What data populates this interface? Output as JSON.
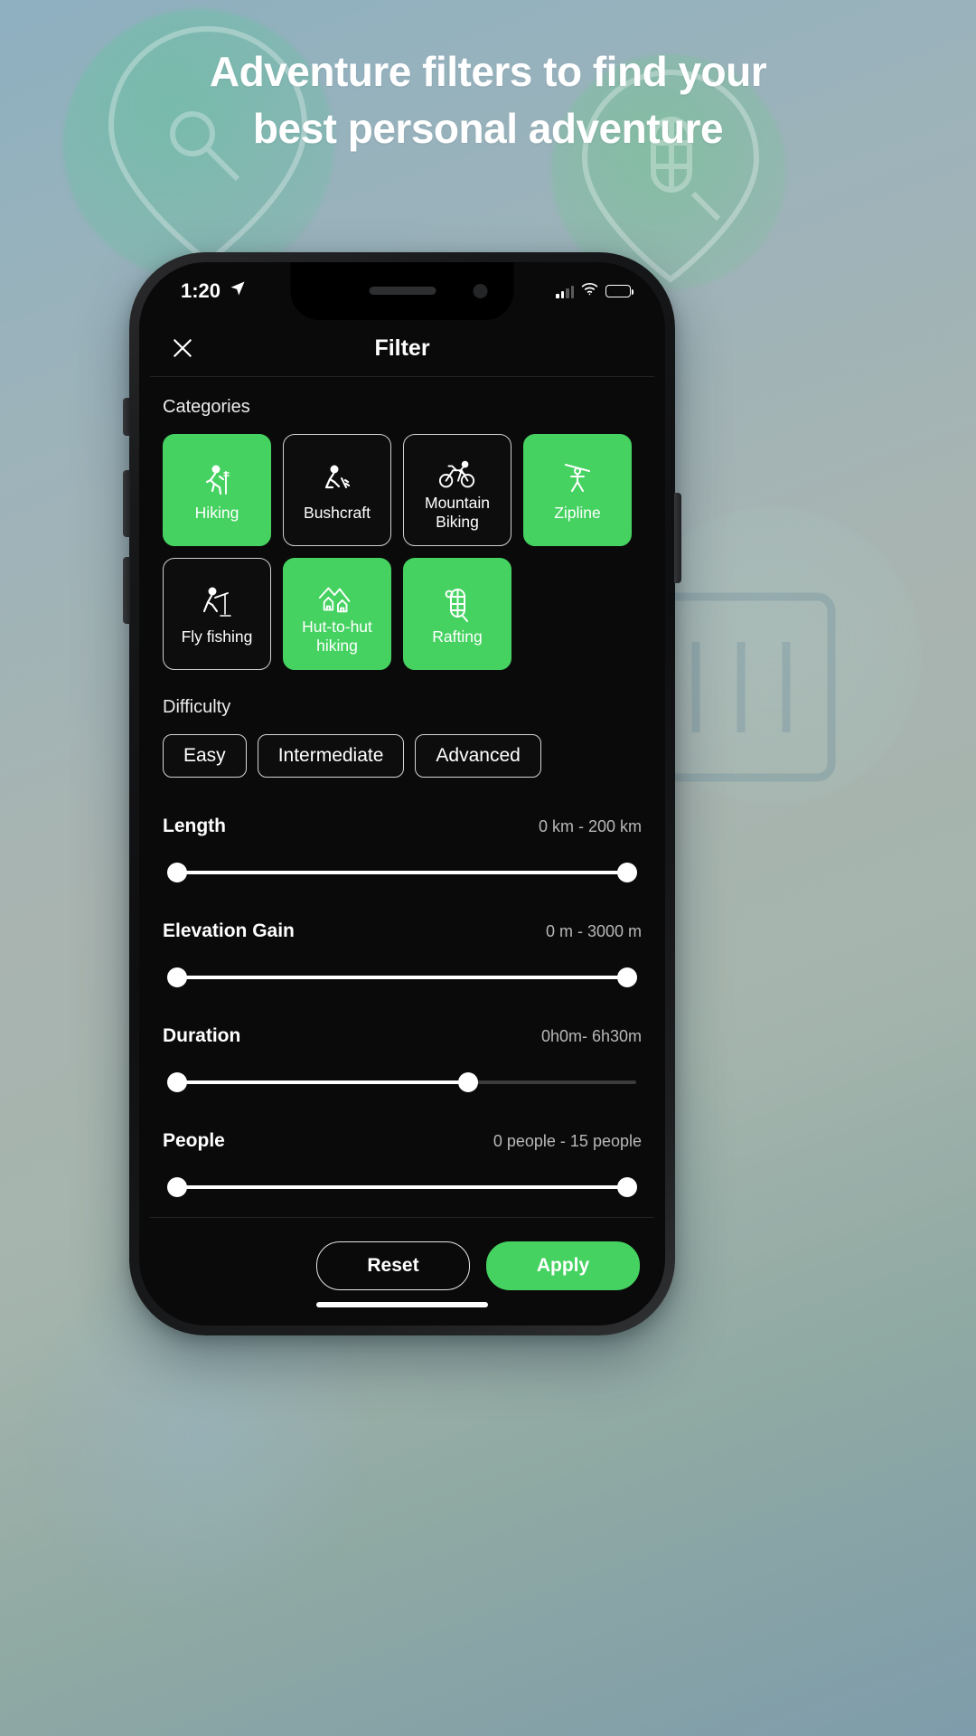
{
  "headline": {
    "line1": "Adventure filters to find your",
    "line2": "best personal adventure"
  },
  "colors": {
    "accent": "#45d261",
    "screen_bg": "#0a0a0a",
    "muted_text": "#b8b8b8"
  },
  "status_bar": {
    "time": "1:20",
    "location_icon": "location-arrow-icon",
    "signal_icon": "cellular-signal-icon",
    "wifi_icon": "wifi-icon",
    "battery_icon": "battery-icon"
  },
  "header": {
    "close_icon": "close-icon",
    "title": "Filter"
  },
  "categories": {
    "label": "Categories",
    "items": [
      {
        "label": "Hiking",
        "icon": "hiking-icon",
        "selected": true
      },
      {
        "label": "Bushcraft",
        "icon": "bushcraft-icon",
        "selected": false
      },
      {
        "label": "Mountain Biking",
        "icon": "mountain-bike-icon",
        "selected": false
      },
      {
        "label": "Zipline",
        "icon": "zipline-icon",
        "selected": true
      },
      {
        "label": "Fly fishing",
        "icon": "fly-fishing-icon",
        "selected": false
      },
      {
        "label": "Hut-to-hut hiking",
        "icon": "hut-hiking-icon",
        "selected": true
      },
      {
        "label": "Rafting",
        "icon": "rafting-icon",
        "selected": true
      }
    ]
  },
  "difficulty": {
    "label": "Difficulty",
    "options": [
      {
        "label": "Easy",
        "selected": false
      },
      {
        "label": "Intermediate",
        "selected": false
      },
      {
        "label": "Advanced",
        "selected": false
      }
    ]
  },
  "sliders": [
    {
      "name": "Length",
      "value": "0 km - 200 km",
      "left_pct": 2,
      "right_pct": 98
    },
    {
      "name": "Elevation Gain",
      "value": "0 m - 3000 m",
      "left_pct": 2,
      "right_pct": 98
    },
    {
      "name": "Duration",
      "value": "0h0m- 6h30m",
      "left_pct": 2,
      "right_pct": 64
    },
    {
      "name": "People",
      "value": "0 people - 15 people",
      "left_pct": 2,
      "right_pct": 98
    }
  ],
  "footer": {
    "reset_label": "Reset",
    "apply_label": "Apply"
  }
}
